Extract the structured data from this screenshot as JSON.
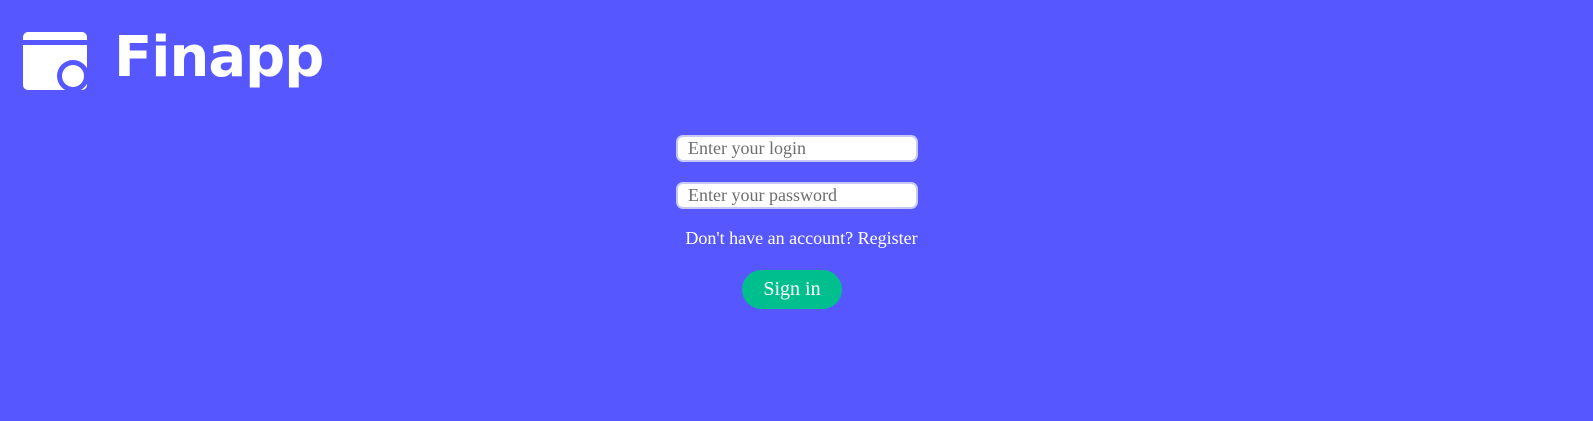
{
  "brand": {
    "name": "Finapp",
    "logo_icon": "wallet-icon",
    "background_color": "#5757ff"
  },
  "login_form": {
    "login_placeholder": "Enter your login",
    "password_placeholder": "Enter your password",
    "register_prompt": "Don't have an account?",
    "register_link_label": "Register",
    "submit_label": "Sign in",
    "submit_color": "#00bf8f"
  }
}
